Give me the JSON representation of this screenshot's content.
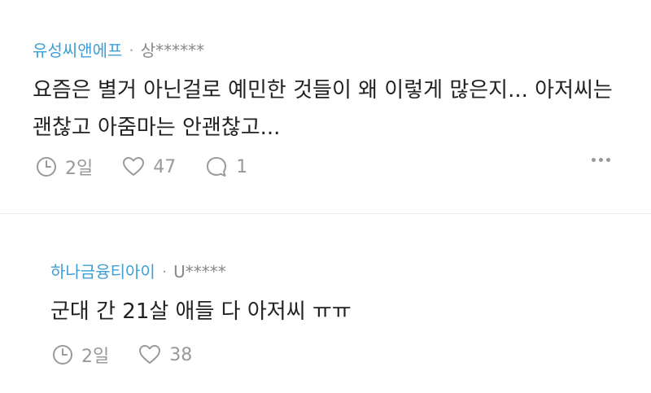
{
  "comments": [
    {
      "author": "유성씨앤에프",
      "user_id": "상******",
      "separator": "·",
      "text": "요즘은 별거 아닌걸로 예민한 것들이 왜 이렇게 많은지... 아저씨는 괜찮고 아줌마는 안괜찮고...",
      "time": "2일",
      "likes": "47",
      "replies": "1"
    },
    {
      "author": "하나금융티아이",
      "user_id": "U*****",
      "separator": "·",
      "text": "군대 간 21살 애들 다 아저씨 ㅠㅠ",
      "time": "2일",
      "likes": "38"
    }
  ],
  "colors": {
    "author": "#3d9fd6",
    "meta": "#888888",
    "icon": "#9a9a9a"
  },
  "icons": [
    "clock-icon",
    "heart-icon",
    "comment-icon",
    "more-icon"
  ]
}
